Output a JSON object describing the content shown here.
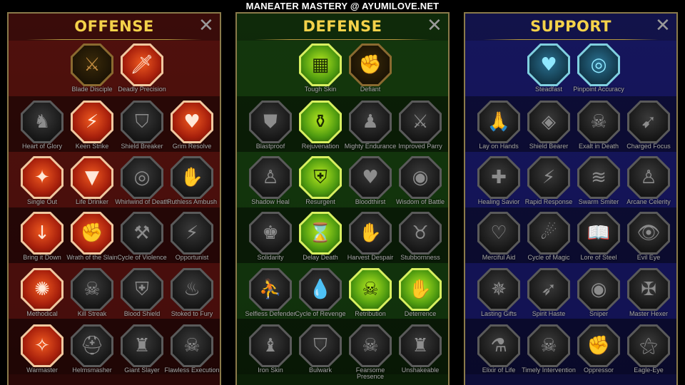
{
  "title": "MANEATER MASTERY @ AYUMILOVE.NET",
  "panels": [
    {
      "key": "offense",
      "name": "OFFENSE",
      "tiers": [
        [
          {
            "label": "Blade Disciple",
            "icon": "crossed-swords-icon",
            "glyph": "⚔",
            "state": "gold-dark"
          },
          {
            "label": "Deadly Precision",
            "icon": "dagger-icon",
            "glyph": "🗡",
            "state": "on-off"
          }
        ],
        [
          {
            "label": "Heart of Glory",
            "icon": "horned-helm-icon",
            "glyph": "♞",
            "state": "dim"
          },
          {
            "label": "Keen Strike",
            "icon": "claw-slash-icon",
            "glyph": "⚡",
            "state": "on-off"
          },
          {
            "label": "Shield Breaker",
            "icon": "broken-shield-icon",
            "glyph": "⛉",
            "state": "dim"
          },
          {
            "label": "Grim Resolve",
            "icon": "heart-blade-icon",
            "glyph": "♥",
            "state": "on-off"
          }
        ],
        [
          {
            "label": "Single Out",
            "icon": "target-figure-icon",
            "glyph": "✦",
            "state": "on-off"
          },
          {
            "label": "Life Drinker",
            "icon": "fangs-icon",
            "glyph": "▼",
            "state": "on-off"
          },
          {
            "label": "Whirlwind of Death",
            "icon": "whirlwind-icon",
            "glyph": "◎",
            "state": "dim"
          },
          {
            "label": "Ruthless Ambush",
            "icon": "hand-dagger-icon",
            "glyph": "✋",
            "state": "dim"
          }
        ],
        [
          {
            "label": "Bring it Down",
            "icon": "sword-down-icon",
            "glyph": "↓",
            "state": "on-off"
          },
          {
            "label": "Wrath of the Slain",
            "icon": "fist-icon",
            "glyph": "✊",
            "state": "on-off"
          },
          {
            "label": "Cycle of Violence",
            "icon": "axe-icon",
            "glyph": "⚒",
            "state": "dim"
          },
          {
            "label": "Opportunist",
            "icon": "chain-lightning-icon",
            "glyph": "⚡",
            "state": "dim"
          }
        ],
        [
          {
            "label": "Methodical",
            "icon": "radial-blades-icon",
            "glyph": "✺",
            "state": "on-off"
          },
          {
            "label": "Kill Streak",
            "icon": "skull-icon",
            "glyph": "☠",
            "state": "dim"
          },
          {
            "label": "Blood Shield",
            "icon": "sword-shield-icon",
            "glyph": "⛨",
            "state": "dim"
          },
          {
            "label": "Stoked to Fury",
            "icon": "raging-figure-icon",
            "glyph": "♨",
            "state": "dim"
          }
        ],
        [
          {
            "label": "Warmaster",
            "icon": "sword-sparks-icon",
            "glyph": "✧",
            "state": "on-off"
          },
          {
            "label": "Helmsmasher",
            "icon": "helm-icon",
            "glyph": "⛑",
            "state": "dim"
          },
          {
            "label": "Giant Slayer",
            "icon": "giant-icon",
            "glyph": "♜",
            "state": "dim"
          },
          {
            "label": "Flawless Execution",
            "icon": "skull-blade-icon",
            "glyph": "☠",
            "state": "dim"
          }
        ]
      ]
    },
    {
      "key": "defense",
      "name": "DEFENSE",
      "tiers": [
        [
          {
            "label": "Tough Skin",
            "icon": "armor-plates-icon",
            "glyph": "▦",
            "state": "on-def"
          },
          {
            "label": "Defiant",
            "icon": "raised-fist-icon",
            "glyph": "✊",
            "state": "gold-dark"
          }
        ],
        [
          {
            "label": "Blastproof",
            "icon": "chevron-shield-icon",
            "glyph": "⛊",
            "state": "dim"
          },
          {
            "label": "Rejuvenation",
            "icon": "potion-hand-icon",
            "glyph": "⚱",
            "state": "on-def"
          },
          {
            "label": "Mighty Endurance",
            "icon": "muscle-figure-icon",
            "glyph": "♟",
            "state": "dim"
          },
          {
            "label": "Improved Parry",
            "icon": "crossed-blades-icon",
            "glyph": "⚔",
            "state": "dim"
          }
        ],
        [
          {
            "label": "Shadow Heal",
            "icon": "shadow-figure-icon",
            "glyph": "♙",
            "state": "dim"
          },
          {
            "label": "Resurgent",
            "icon": "knight-shield-icon",
            "glyph": "⛨",
            "state": "on-def"
          },
          {
            "label": "Bloodthirst",
            "icon": "heart-skull-icon",
            "glyph": "♥",
            "state": "dim"
          },
          {
            "label": "Wisdom of Battle",
            "icon": "hooded-head-icon",
            "glyph": "◉",
            "state": "dim"
          }
        ],
        [
          {
            "label": "Solidarity",
            "icon": "crowd-icon",
            "glyph": "♚",
            "state": "dim"
          },
          {
            "label": "Delay Death",
            "icon": "hourglass-icon",
            "glyph": "⌛",
            "state": "on-def"
          },
          {
            "label": "Harvest Despair",
            "icon": "open-hand-icon",
            "glyph": "✋",
            "state": "dim"
          },
          {
            "label": "Stubbornness",
            "icon": "bull-head-icon",
            "glyph": "♉",
            "state": "dim"
          }
        ],
        [
          {
            "label": "Selfless Defender",
            "icon": "running-figure-icon",
            "glyph": "⛹",
            "state": "dim"
          },
          {
            "label": "Cycle of Revenge",
            "icon": "blood-drops-icon",
            "glyph": "💧",
            "state": "dim"
          },
          {
            "label": "Retribution",
            "icon": "skull-burst-icon",
            "glyph": "☠",
            "state": "on-def"
          },
          {
            "label": "Deterrence",
            "icon": "hand-sword-icon",
            "glyph": "✋",
            "state": "on-def"
          }
        ],
        [
          {
            "label": "Iron Skin",
            "icon": "armored-warrior-icon",
            "glyph": "♝",
            "state": "dim"
          },
          {
            "label": "Bulwark",
            "icon": "tower-shield-icon",
            "glyph": "⛉",
            "state": "dim"
          },
          {
            "label": "Fearsome Presence",
            "icon": "demon-skull-icon",
            "glyph": "☠",
            "state": "dim"
          },
          {
            "label": "Unshakeable",
            "icon": "strong-figure-icon",
            "glyph": "♜",
            "state": "dim"
          }
        ]
      ]
    },
    {
      "key": "support",
      "name": "SUPPORT",
      "tiers": [
        [
          {
            "label": "Steadfast",
            "icon": "heart-hands-icon",
            "glyph": "♥",
            "state": "on-sup"
          },
          {
            "label": "Pinpoint Accuracy",
            "icon": "bullseye-arrow-icon",
            "glyph": "◎",
            "state": "on-sup"
          }
        ],
        [
          {
            "label": "Lay on Hands",
            "icon": "praying-hands-icon",
            "glyph": "🙏",
            "state": "dim"
          },
          {
            "label": "Shield Bearer",
            "icon": "shield-rings-icon",
            "glyph": "◈",
            "state": "dim"
          },
          {
            "label": "Exalt in Death",
            "icon": "flaming-skull-icon",
            "glyph": "☠",
            "state": "dim"
          },
          {
            "label": "Charged Focus",
            "icon": "charged-hand-icon",
            "glyph": "➹",
            "state": "dim"
          }
        ],
        [
          {
            "label": "Healing Savior",
            "icon": "healer-figure-icon",
            "glyph": "✚",
            "state": "dim"
          },
          {
            "label": "Rapid Response",
            "icon": "lightning-shield-icon",
            "glyph": "⚡",
            "state": "dim"
          },
          {
            "label": "Swarm Smiter",
            "icon": "swarm-icon",
            "glyph": "≋",
            "state": "dim"
          },
          {
            "label": "Arcane Celerity",
            "icon": "arcane-figure-icon",
            "glyph": "♙",
            "state": "dim"
          }
        ],
        [
          {
            "label": "Merciful Aid",
            "icon": "chained-heart-icon",
            "glyph": "♡",
            "state": "dim"
          },
          {
            "label": "Cycle of Magic",
            "icon": "magic-swirl-icon",
            "glyph": "☄",
            "state": "dim"
          },
          {
            "label": "Lore of Steel",
            "icon": "open-book-icon",
            "glyph": "📖",
            "state": "dim"
          },
          {
            "label": "Evil Eye",
            "icon": "eye-burst-icon",
            "glyph": "👁",
            "state": "dim"
          }
        ],
        [
          {
            "label": "Lasting Gifts",
            "icon": "compass-star-icon",
            "glyph": "✵",
            "state": "dim"
          },
          {
            "label": "Spirit Haste",
            "icon": "winged-boot-icon",
            "glyph": "➶",
            "state": "dim"
          },
          {
            "label": "Sniper",
            "icon": "eye-target-icon",
            "glyph": "◉",
            "state": "dim"
          },
          {
            "label": "Master Hexer",
            "icon": "hexer-figure-icon",
            "glyph": "✠",
            "state": "dim"
          }
        ],
        [
          {
            "label": "Elixir of Life",
            "icon": "flask-icon",
            "glyph": "⚗",
            "state": "dim"
          },
          {
            "label": "Timely Intervention",
            "icon": "hooded-skull-icon",
            "glyph": "☠",
            "state": "dim"
          },
          {
            "label": "Oppressor",
            "icon": "gauntlet-icon",
            "glyph": "✊",
            "state": "dim"
          },
          {
            "label": "Eagle-Eye",
            "icon": "eagle-head-icon",
            "glyph": "⚝",
            "state": "dim"
          }
        ]
      ]
    }
  ],
  "close_glyph": "✕"
}
